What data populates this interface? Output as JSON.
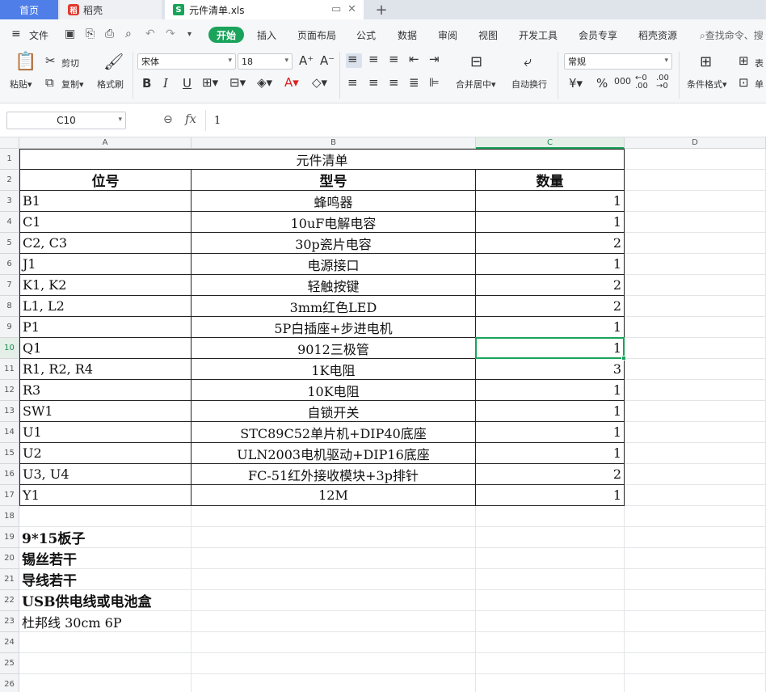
{
  "tabs": {
    "home": "首页",
    "daoke": "稻壳",
    "file": "元件清单.xls"
  },
  "menu": {
    "file": "文件",
    "items": [
      "开始",
      "插入",
      "页面布局",
      "公式",
      "数据",
      "审阅",
      "视图",
      "开发工具",
      "会员专享",
      "稻壳资源"
    ],
    "search": "查找命令、搜"
  },
  "ribbon": {
    "paste": "粘贴",
    "cut": "剪切",
    "copy": "复制",
    "format_painter": "格式刷",
    "font": "宋体",
    "font_size": "18",
    "merge_center": "合并居中",
    "wrap": "自动换行",
    "number_format": "常规",
    "cond_format": "条件格式",
    "table_style": "表",
    "cell_style": "单"
  },
  "formula_bar": {
    "name_box": "C10",
    "fx": "fx",
    "value": "1"
  },
  "columns": [
    "A",
    "B",
    "C",
    "D"
  ],
  "active": {
    "column": "C",
    "row": 10
  },
  "sheet": {
    "title": "元件清单",
    "headers": [
      "位号",
      "型号",
      "数量"
    ],
    "rows": [
      [
        "B1",
        "蜂鸣器",
        "1"
      ],
      [
        "C1",
        "10uF电解电容",
        "1"
      ],
      [
        "C2, C3",
        "30p瓷片电容",
        "2"
      ],
      [
        "J1",
        "电源接口",
        "1"
      ],
      [
        "K1, K2",
        "轻触按键",
        "2"
      ],
      [
        "L1, L2",
        "3mm红色LED",
        "2"
      ],
      [
        "P1",
        "5P白插座+步进电机",
        "1"
      ],
      [
        "Q1",
        "9012三极管",
        "1"
      ],
      [
        "R1, R2, R4",
        "1K电阻",
        "3"
      ],
      [
        "R3",
        "10K电阻",
        "1"
      ],
      [
        "SW1",
        "自锁开关",
        "1"
      ],
      [
        "U1",
        "STC89C52单片机+DIP40底座",
        "1"
      ],
      [
        "U2",
        "ULN2003电机驱动+DIP16底座",
        "1"
      ],
      [
        "U3, U4",
        "FC-51红外接收模块+3p排针",
        "2"
      ],
      [
        "Y1",
        "12M",
        "1"
      ]
    ],
    "notes": [
      "9*15板子",
      "锡丝若干",
      "导线若干",
      "USB供电线或电池盒",
      "杜邦线  30cm 6P"
    ]
  },
  "colors": {
    "accent": "#1aa35b",
    "home_tab": "#4f7ee8"
  }
}
